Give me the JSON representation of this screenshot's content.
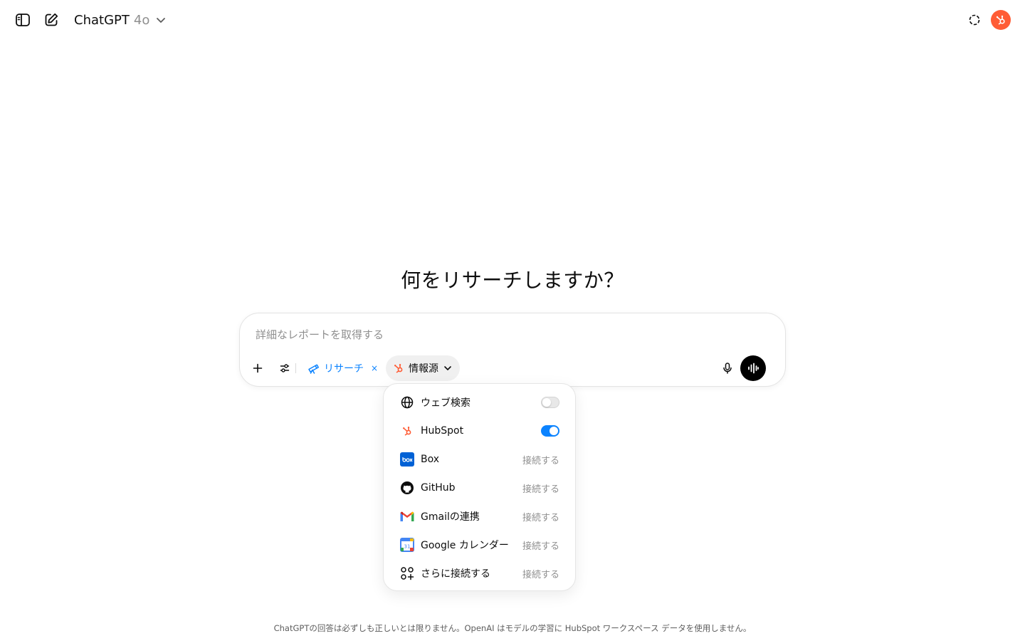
{
  "header": {
    "model_name": "ChatGPT",
    "model_version": "4o"
  },
  "main": {
    "headline": "何をリサーチしますか？"
  },
  "composer": {
    "placeholder": "詳細なレポートを取得する",
    "research_label": "リサーチ",
    "research_remove": "×",
    "sources_label": "情報源"
  },
  "sources_menu": {
    "items": [
      {
        "label": "ウェブ検索",
        "type": "toggle",
        "enabled": false
      },
      {
        "label": "HubSpot",
        "type": "toggle",
        "enabled": true
      },
      {
        "label": "Box",
        "type": "connect",
        "action": "接続する"
      },
      {
        "label": "GitHub",
        "type": "connect",
        "action": "接続する"
      },
      {
        "label": "Gmailの連携",
        "type": "connect",
        "action": "接続する"
      },
      {
        "label": "Google カレンダー",
        "type": "connect",
        "action": "接続する"
      },
      {
        "label": "さらに接続する",
        "type": "connect",
        "action": "接続する"
      }
    ]
  },
  "footer": {
    "disclaimer": "ChatGPTの回答は必ずしも正しいとは限りません。OpenAI はモデルの学習に HubSpot ワークスペース データを使用しません。"
  },
  "colors": {
    "accent": "#0b83ff",
    "hubspot": "#ff5c35",
    "muted": "#8f8f8f"
  }
}
